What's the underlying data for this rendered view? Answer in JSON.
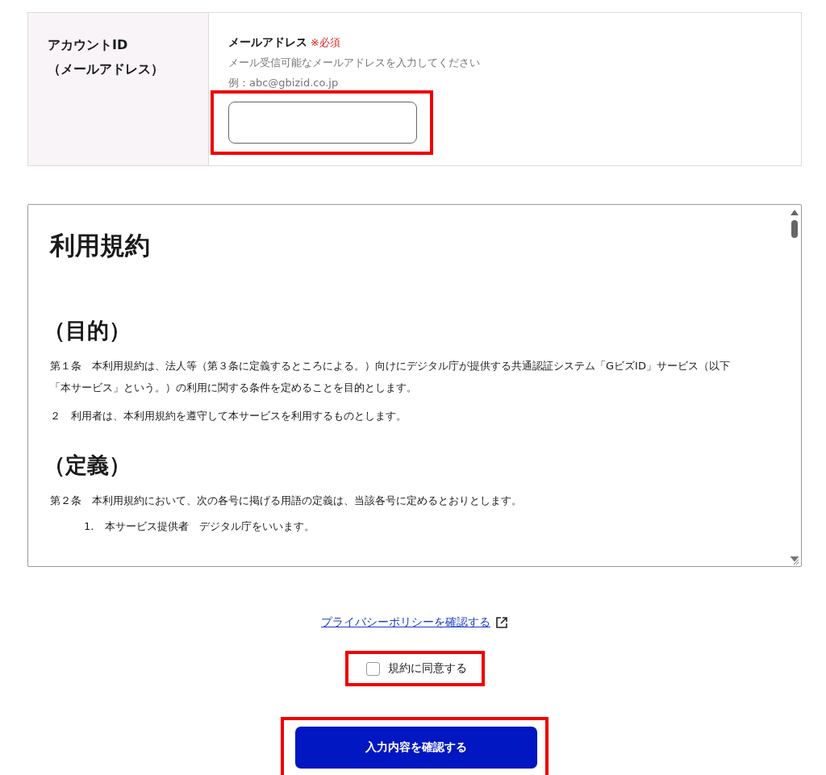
{
  "account_row": {
    "label_lines": [
      "アカウントID",
      "（メールアドレス）"
    ],
    "field_label": "メールアドレス",
    "required_mark": "※必須",
    "hint": "メール受信可能なメールアドレスを入力してください",
    "example": "例：abc@gbizid.co.jp",
    "highlighted": true
  },
  "terms": {
    "title": "利用規約",
    "blocks": [
      {
        "kind": "heading",
        "text": "（目的）"
      },
      {
        "kind": "paragraph",
        "text": "第１条　本利用規約は、法人等（第３条に定義するところによる。）向けにデジタル庁が提供する共通認証システム「GビズID」サービス（以下「本サービス」という。）の利用に関する条件を定めることを目的とします。"
      },
      {
        "kind": "paragraph",
        "text": "２　利用者は、本利用規約を遵守して本サービスを利用するものとします。"
      },
      {
        "kind": "heading",
        "text": "（定義）"
      },
      {
        "kind": "paragraph",
        "text": "第２条　本利用規約において、次の各号に掲げる用語の定義は、当該各号に定めるとおりとします。"
      },
      {
        "kind": "list_item",
        "number": "1.",
        "text": "本サービス提供者　デジタル庁をいいます。"
      }
    ]
  },
  "privacy_link": "プライバシーポリシーを確認する",
  "agree": {
    "label": "規約に同意する",
    "checked": false,
    "highlighted": true
  },
  "submit": {
    "label": "入力内容を確認する",
    "highlighted": true
  }
}
